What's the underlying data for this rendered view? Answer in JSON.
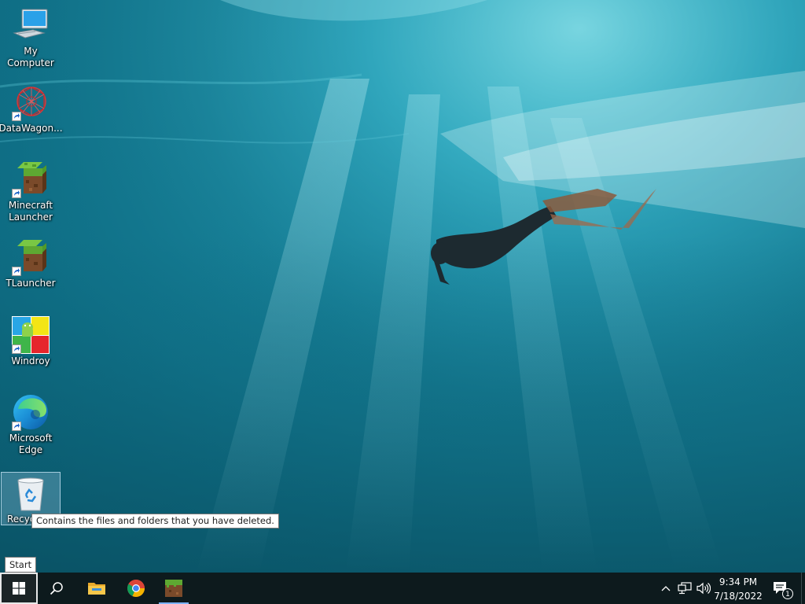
{
  "desktop": {
    "icons": [
      {
        "label": "My Computer",
        "icon": "computer-icon"
      },
      {
        "label": "DataWagon...",
        "icon": "datawagon-icon"
      },
      {
        "label": "Minecraft Launcher",
        "icon": "minecraft-grass-block-icon"
      },
      {
        "label": "TLauncher",
        "icon": "tlauncher-grass-block-icon"
      },
      {
        "label": "Windroy",
        "icon": "windroy-icon"
      },
      {
        "label": "Microsoft Edge",
        "icon": "edge-icon"
      },
      {
        "label": "Recyc",
        "icon": "recycle-bin-icon"
      }
    ],
    "tooltip": "Contains the files and folders that you have deleted."
  },
  "taskbar": {
    "start_tooltip": "Start",
    "pinned": [
      {
        "name": "search",
        "icon": "search-icon"
      },
      {
        "name": "file-explorer",
        "icon": "folder-icon"
      },
      {
        "name": "chrome",
        "icon": "chrome-icon"
      },
      {
        "name": "minecraft",
        "icon": "minecraft-grass-block-icon"
      }
    ],
    "tray": {
      "time": "9:34 PM",
      "date": "7/18/2022",
      "notification_count": "1"
    }
  },
  "colors": {
    "taskbar": "#0d1a1d",
    "active_indicator": "#7db4ff",
    "water_light": "#3fb6c9",
    "water_deep": "#0b5f74"
  }
}
